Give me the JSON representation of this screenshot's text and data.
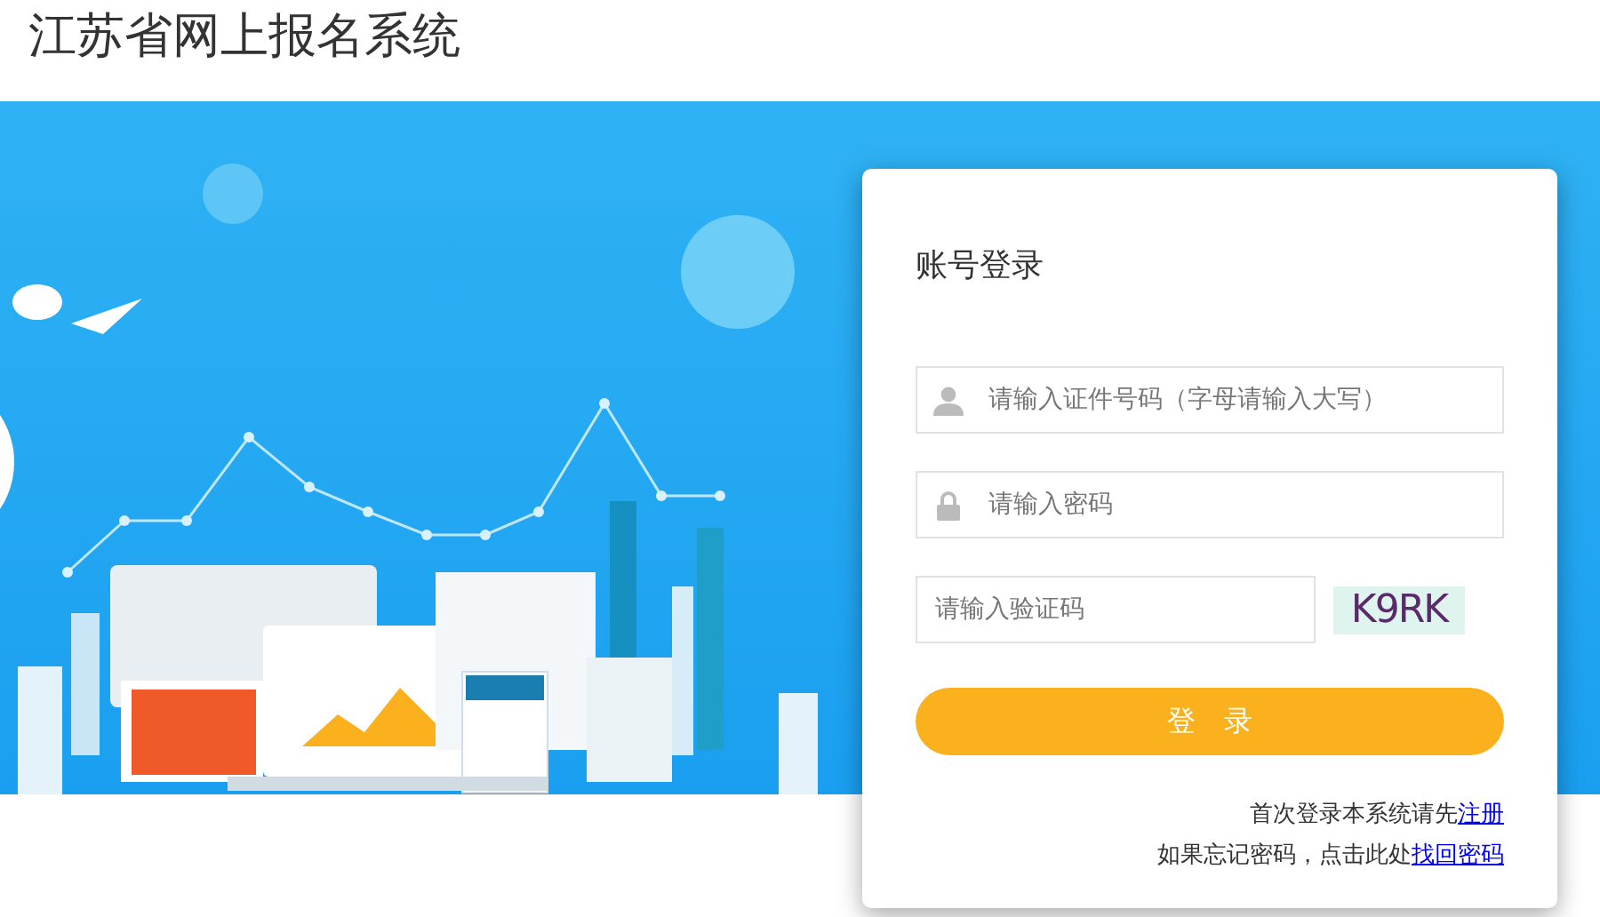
{
  "header": {
    "title": "江苏省网上报名系统"
  },
  "login": {
    "title": "账号登录",
    "fields": [
      {
        "kind": "user",
        "placeholder": "请输入证件号码（字母请输入大写）"
      },
      {
        "kind": "lock",
        "placeholder": "请输入密码"
      }
    ],
    "captcha": {
      "placeholder": "请输入验证码",
      "code": "K9RK"
    },
    "submit": "登　录",
    "notes": [
      {
        "text": "首次登录本系统请先",
        "link": "注册"
      },
      {
        "text": "如果忘记密码，点击此处",
        "link": "找回密码"
      }
    ]
  }
}
